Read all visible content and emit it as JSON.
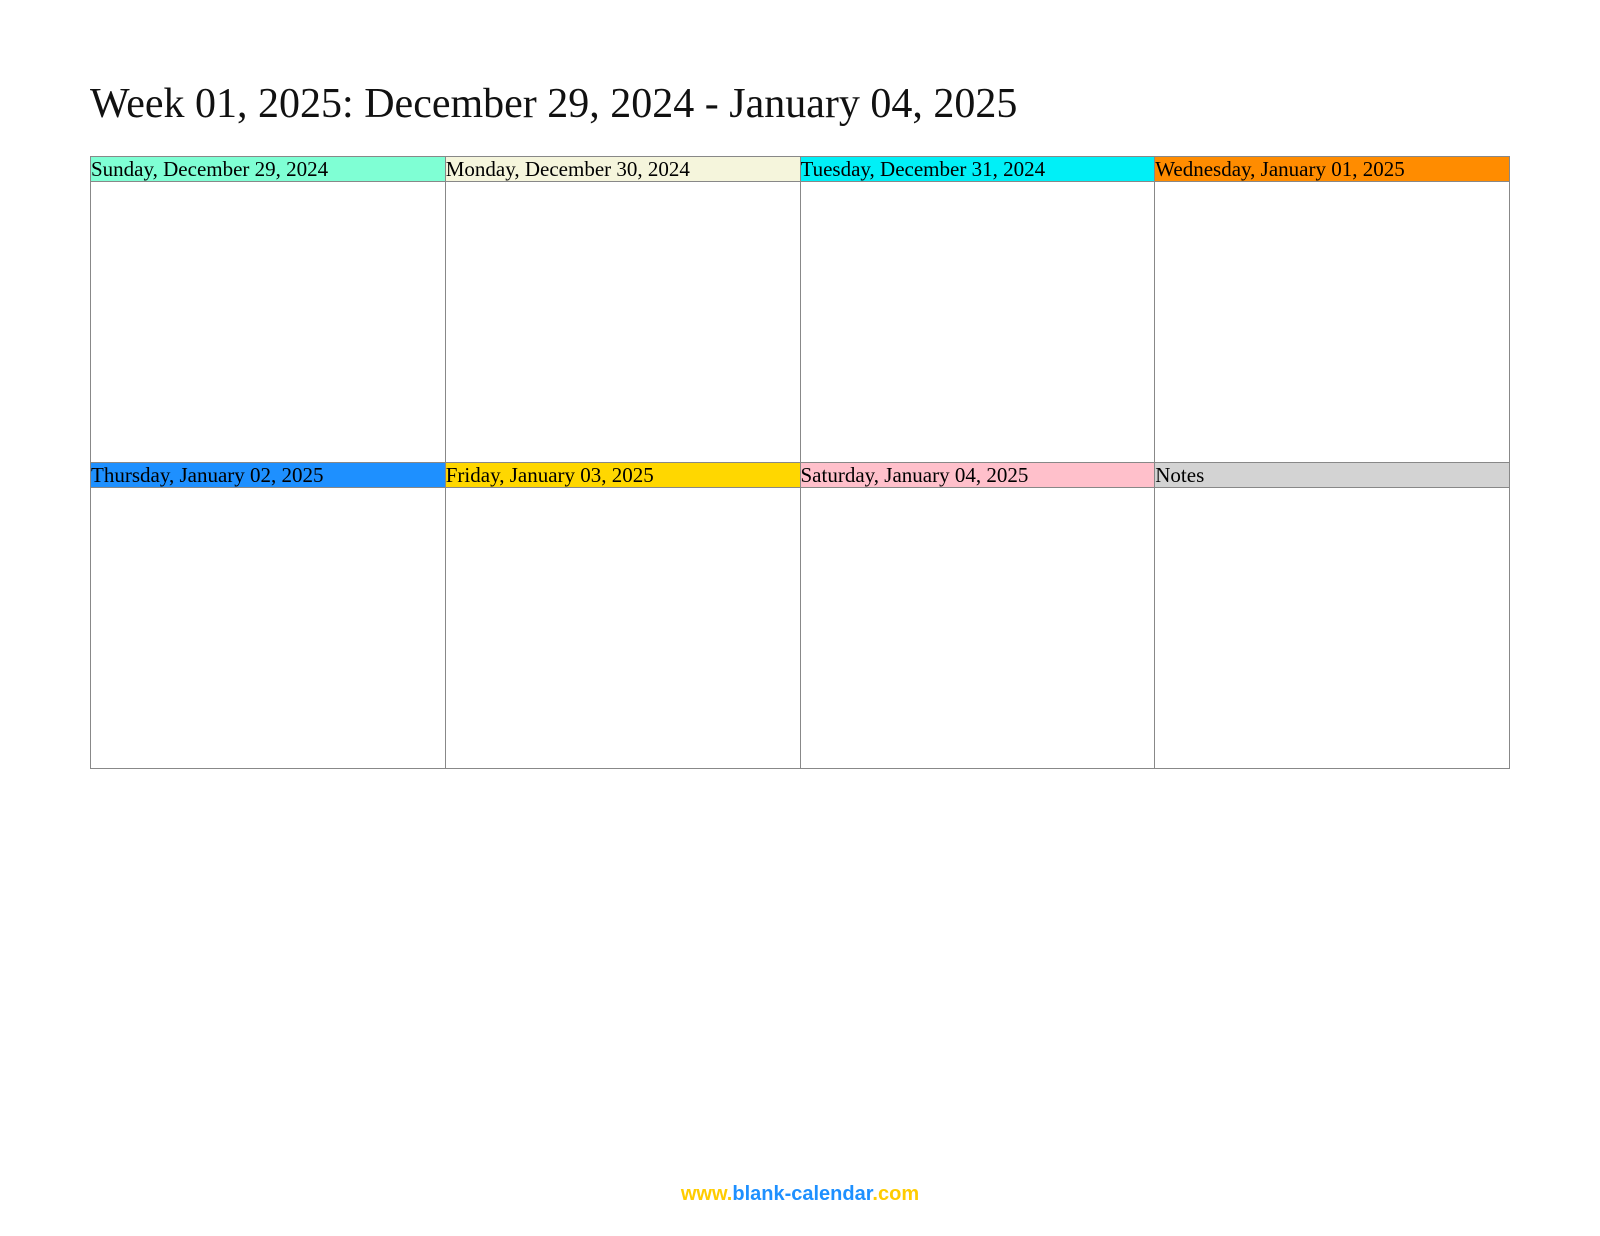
{
  "title": "Week 01, 2025: December 29, 2024 - January 04, 2025",
  "cells": {
    "row1": [
      {
        "label": "Sunday, December 29, 2024",
        "bg": "#7FFFD4"
      },
      {
        "label": "Monday, December 30, 2024",
        "bg": "#F5F5DC"
      },
      {
        "label": "Tuesday, December 31, 2024",
        "bg": "#00F0F7"
      },
      {
        "label": "Wednesday, January 01, 2025",
        "bg": "#FF8C00"
      }
    ],
    "row2": [
      {
        "label": "Thursday, January 02, 2025",
        "bg": "#1E90FF"
      },
      {
        "label": "Friday, January 03, 2025",
        "bg": "#FFD700"
      },
      {
        "label": "Saturday, January 04, 2025",
        "bg": "#FFC0CB"
      },
      {
        "label": "Notes",
        "bg": "#D3D3D3"
      }
    ]
  },
  "footer": {
    "part1": "www.",
    "part2": "blank-calendar",
    "part3": ".com"
  }
}
